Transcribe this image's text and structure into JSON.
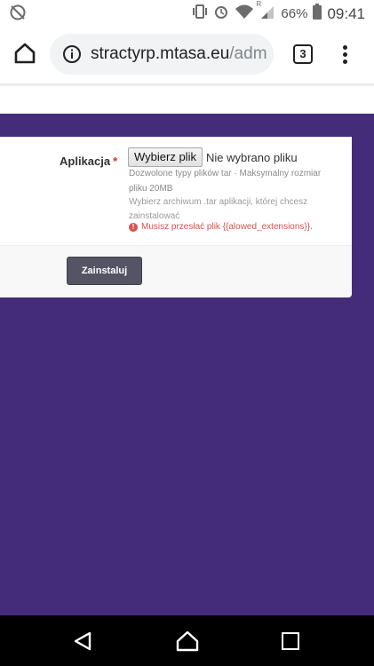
{
  "status_bar": {
    "battery_percent": "66%",
    "time": "09:41",
    "signal_indicator": "R",
    "icons": [
      "no-sync-icon",
      "vibrate-icon",
      "alarm-icon",
      "wifi-icon",
      "signal-icon",
      "battery-icon"
    ]
  },
  "browser": {
    "url_host": "stractyrp.mtasa.eu",
    "url_path": "/adm",
    "tab_count": "3",
    "icons": [
      "home-icon",
      "info-icon",
      "tabs-icon",
      "menu-icon"
    ]
  },
  "form": {
    "field_label": "Aplikacja",
    "required_mark": "*",
    "file_button_label": "Wybierz plik",
    "file_status": "Nie wybrano pliku",
    "hint_types": "Dozwolone typy plików tar · Maksymalny rozmiar pliku 20MB",
    "hint_description": "Wybierz archiwum .tar aplikacji, której chcesz zainstalować",
    "error_message": "Musisz przesłać plik {{alowed_extensions}}.",
    "submit_label": "Zainstaluj"
  },
  "colors": {
    "page_background": "#452c7b",
    "error": "#d9534f",
    "button": "#545465"
  },
  "nav_bar": {
    "icons": [
      "back-icon",
      "home-icon",
      "recent-apps-icon"
    ]
  }
}
